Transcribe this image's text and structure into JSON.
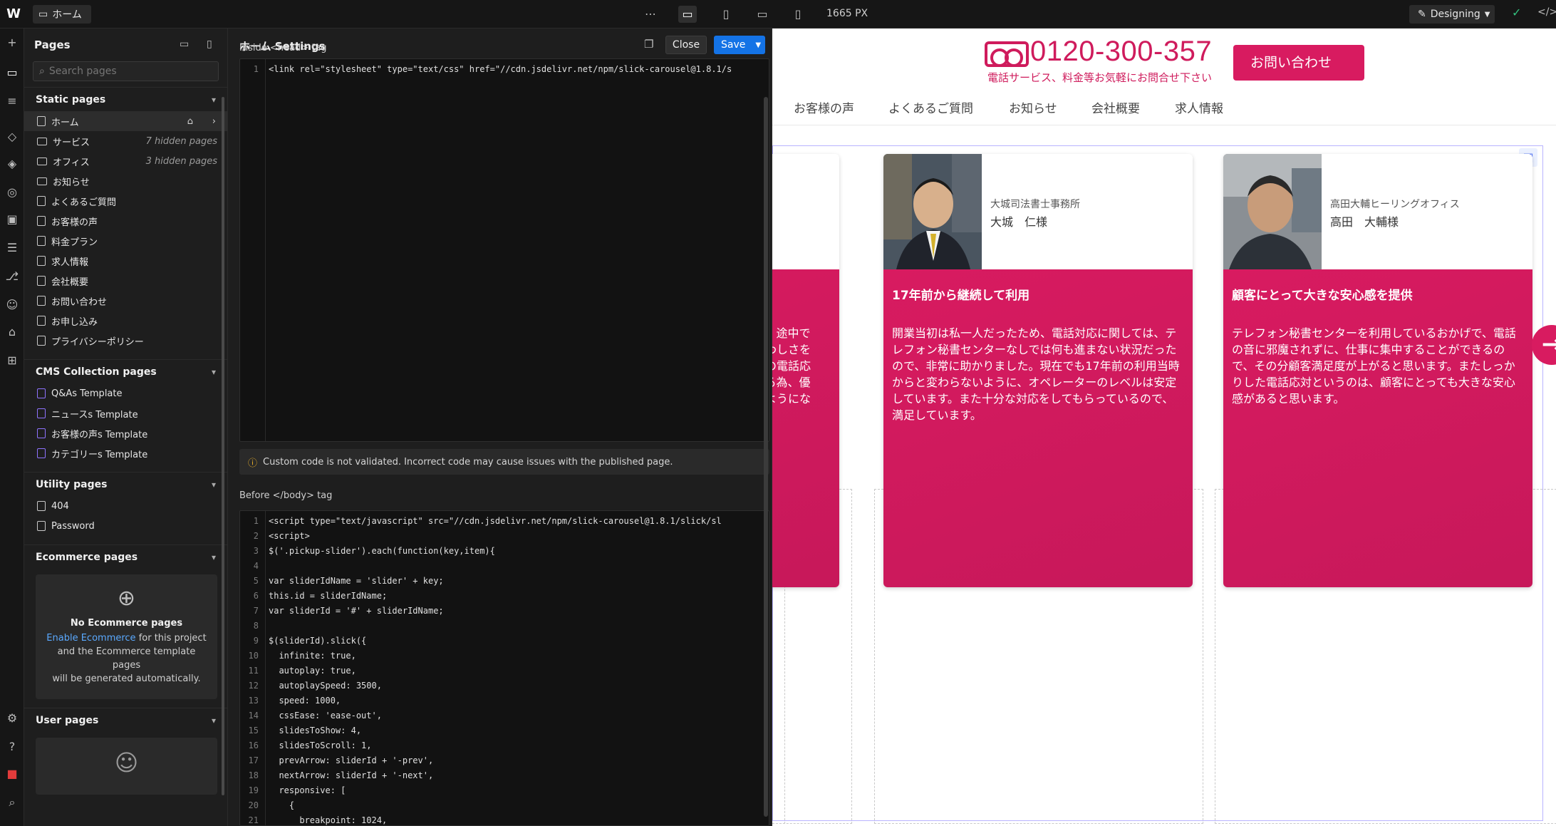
{
  "topbar": {
    "page_tab": "ホーム",
    "width_readout": "1665 PX",
    "mode": "Designing",
    "more": "⋯"
  },
  "pages_panel": {
    "title": "Pages",
    "search_placeholder": "Search pages",
    "static_title": "Static pages",
    "static_pages": [
      {
        "label": "ホーム",
        "meta": ""
      },
      {
        "label": "サービス",
        "meta": "7 hidden pages"
      },
      {
        "label": "オフィス",
        "meta": "3 hidden pages"
      },
      {
        "label": "お知らせ",
        "meta": ""
      },
      {
        "label": "よくあるご質問",
        "meta": ""
      },
      {
        "label": "お客様の声",
        "meta": ""
      },
      {
        "label": "料金プラン",
        "meta": ""
      },
      {
        "label": "求人情報",
        "meta": ""
      },
      {
        "label": "会社概要",
        "meta": ""
      },
      {
        "label": "お問い合わせ",
        "meta": ""
      },
      {
        "label": "お申し込み",
        "meta": ""
      },
      {
        "label": "プライバシーポリシー",
        "meta": ""
      }
    ],
    "cms_title": "CMS Collection pages",
    "cms_pages": [
      "Q&As Template",
      "ニュースs Template",
      "お客様の声s Template",
      "カテゴリーs Template"
    ],
    "utility_title": "Utility pages",
    "utility_pages": [
      "404",
      "Password"
    ],
    "ecommerce_title": "Ecommerce pages",
    "ecommerce_empty_title": "No Ecommerce pages",
    "ecommerce_link": "Enable Ecommerce",
    "ecommerce_desc_1": " for this project",
    "ecommerce_desc_2": "and the Ecommerce template pages",
    "ecommerce_desc_3": "will be generated automatically.",
    "user_title": "User pages"
  },
  "settings": {
    "title": "ホーム Settings",
    "close_label": "Close",
    "save_label": "Save",
    "head_label": "Inside <head> tag",
    "head_code": [
      "<link rel=\"stylesheet\" type=\"text/css\" href=\"//cdn.jsdelivr.net/npm/slick-carousel@1.8.1/s"
    ],
    "warning": "Custom code is not validated. Incorrect code may cause issues with the published page.",
    "body_label": "Before </body> tag",
    "body_code": [
      "<script type=\"text/javascript\" src=\"//cdn.jsdelivr.net/npm/slick-carousel@1.8.1/slick/sl",
      "<script>",
      "$('.pickup-slider').each(function(key,item){",
      "",
      "var sliderIdName = 'slider' + key;",
      "this.id = sliderIdName;",
      "var sliderId = '#' + sliderIdName;",
      "",
      "$(sliderId).slick({",
      "  infinite: true,",
      "  autoplay: true,",
      "  autoplaySpeed: 3500,",
      "  speed: 1000,",
      "  cssEase: 'ease-out',",
      "  slidesToShow: 4,",
      "  slidesToScroll: 1,",
      "  prevArrow: sliderId + '-prev',",
      "  nextArrow: sliderId + '-next',",
      "  responsive: [",
      "    {",
      "      breakpoint: 1024,"
    ]
  },
  "site": {
    "phone": "0120-300-357",
    "phone_sub": "電話サービス、料金等お気軽にお問合せ下さい",
    "contact_button": "お問い合わせ",
    "nav": [
      "お客様の声",
      "よくあるご質問",
      "お知らせ",
      "会社概要",
      "求人情報"
    ],
    "partial_card_lines": [
      "にも、途中で",
      "て煩わしさを",
      "全ての電話応",
      "らえる為、優",
      "運ぶようにな"
    ],
    "cards": [
      {
        "org": "大城司法書士事務所",
        "name": "大城　仁様",
        "title": "17年前から継続して利用",
        "body": "開業当初は私一人だったため、電話対応に関しては、テレフォン秘書センターなしでは何も進まない状況だったので、非常に助かりました。現在でも17年前の利用当時からと変わらないように、オペレーターのレベルは安定しています。また十分な対応をしてもらっているので、満足しています。"
      },
      {
        "org": "高田大輔ヒーリングオフィス",
        "name": "高田　大輔様",
        "title": "顧客にとって大きな安心感を提供",
        "body": "テレフォン秘書センターを利用しているおかげで、電話の音に邪魔されずに、仕事に集中することができるので、その分顧客満足度が上がると思います。またしっかりした電話応対というのは、顧客にとっても大きな安心感があると思います。"
      }
    ]
  }
}
